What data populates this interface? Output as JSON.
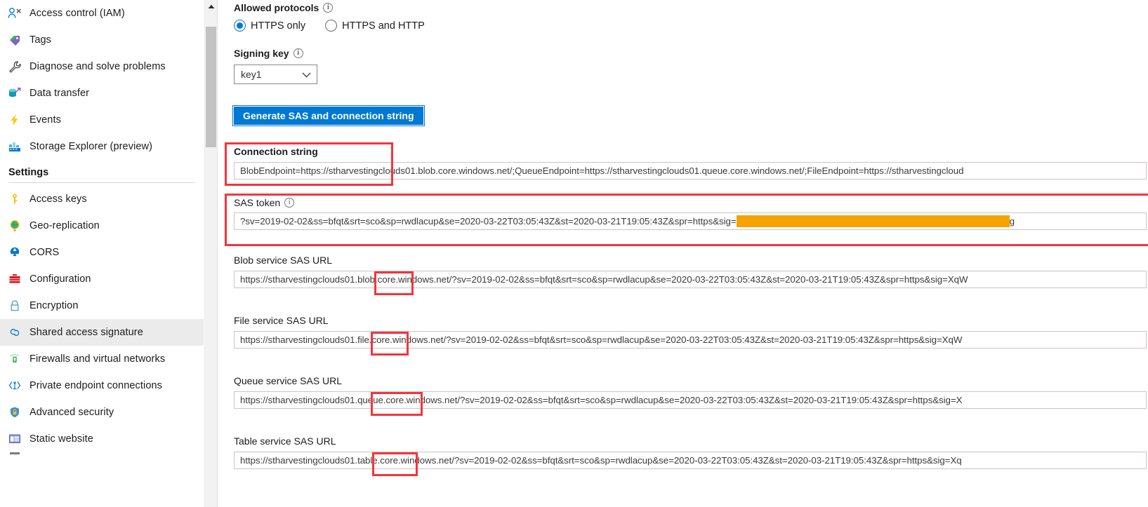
{
  "sidebar": {
    "items": [
      {
        "label": "Access control (IAM)",
        "icon": "people-access-icon",
        "selected": false
      },
      {
        "label": "Tags",
        "icon": "tags-icon",
        "selected": false
      },
      {
        "label": "Diagnose and solve problems",
        "icon": "wrench-icon",
        "selected": false
      },
      {
        "label": "Data transfer",
        "icon": "data-transfer-icon",
        "selected": false
      },
      {
        "label": "Events",
        "icon": "lightning-bolt-icon",
        "selected": false
      },
      {
        "label": "Storage Explorer (preview)",
        "icon": "storage-explorer-icon",
        "selected": false
      }
    ],
    "section_title": "Settings",
    "settings_items": [
      {
        "label": "Access keys",
        "icon": "key-icon",
        "selected": false
      },
      {
        "label": "Geo-replication",
        "icon": "globe-icon",
        "selected": false
      },
      {
        "label": "CORS",
        "icon": "cors-icon",
        "selected": false
      },
      {
        "label": "Configuration",
        "icon": "toolbox-icon",
        "selected": false
      },
      {
        "label": "Encryption",
        "icon": "lock-icon",
        "selected": false
      },
      {
        "label": "Shared access signature",
        "icon": "link-chain-icon",
        "selected": true
      },
      {
        "label": "Firewalls and virtual networks",
        "icon": "firewall-icon",
        "selected": false
      },
      {
        "label": "Private endpoint connections",
        "icon": "private-endpoint-icon",
        "selected": false
      },
      {
        "label": "Advanced security",
        "icon": "shield-icon",
        "selected": false
      },
      {
        "label": "Static website",
        "icon": "static-website-icon",
        "selected": false
      }
    ]
  },
  "main": {
    "allowed_protocols": {
      "label": "Allowed protocols",
      "options": [
        {
          "label": "HTTPS only",
          "selected": true
        },
        {
          "label": "HTTPS and HTTP",
          "selected": false
        }
      ]
    },
    "signing_key": {
      "label": "Signing key",
      "value": "key1"
    },
    "generate_button": "Generate SAS and connection string",
    "connection_string": {
      "label": "Connection string",
      "value": "BlobEndpoint=https://stharvestingclouds01.blob.core.windows.net/;QueueEndpoint=https://stharvestingclouds01.queue.core.windows.net/;FileEndpoint=https://stharvestingcloud"
    },
    "sas_token": {
      "label": "SAS token",
      "value_before_redaction": "?sv=2019-02-02&ss=bfqt&srt=sco&sp=rwdlacup&se=2020-03-22T03:05:43Z&st=2020-03-21T19:05:43Z&spr=https&sig=",
      "value_after_redaction": "g"
    },
    "blob_sas_url": {
      "label": "Blob service SAS URL",
      "value": "https://stharvestingclouds01.blob.core.windows.net/?sv=2019-02-02&ss=bfqt&srt=sco&sp=rwdlacup&se=2020-03-22T03:05:43Z&st=2020-03-21T19:05:43Z&spr=https&sig=XqW"
    },
    "file_sas_url": {
      "label": "File service SAS URL",
      "value": "https://stharvestingclouds01.file.core.windows.net/?sv=2019-02-02&ss=bfqt&srt=sco&sp=rwdlacup&se=2020-03-22T03:05:43Z&st=2020-03-21T19:05:43Z&spr=https&sig=XqW"
    },
    "queue_sas_url": {
      "label": "Queue service SAS URL",
      "value": "https://stharvestingclouds01.queue.core.windows.net/?sv=2019-02-02&ss=bfqt&srt=sco&sp=rwdlacup&se=2020-03-22T03:05:43Z&st=2020-03-21T19:05:43Z&spr=https&sig=X"
    },
    "table_sas_url": {
      "label": "Table service SAS URL",
      "value": "https://stharvestingclouds01.table.core.windows.net/?sv=2019-02-02&ss=bfqt&srt=sco&sp=rwdlacup&se=2020-03-22T03:05:43Z&st=2020-03-21T19:05:43Z&spr=https&sig=Xq"
    }
  },
  "colors": {
    "accent": "#0078d4",
    "annotation": "#f5343c",
    "redaction": "#f5a300",
    "selected_nav": "#ebebeb"
  }
}
